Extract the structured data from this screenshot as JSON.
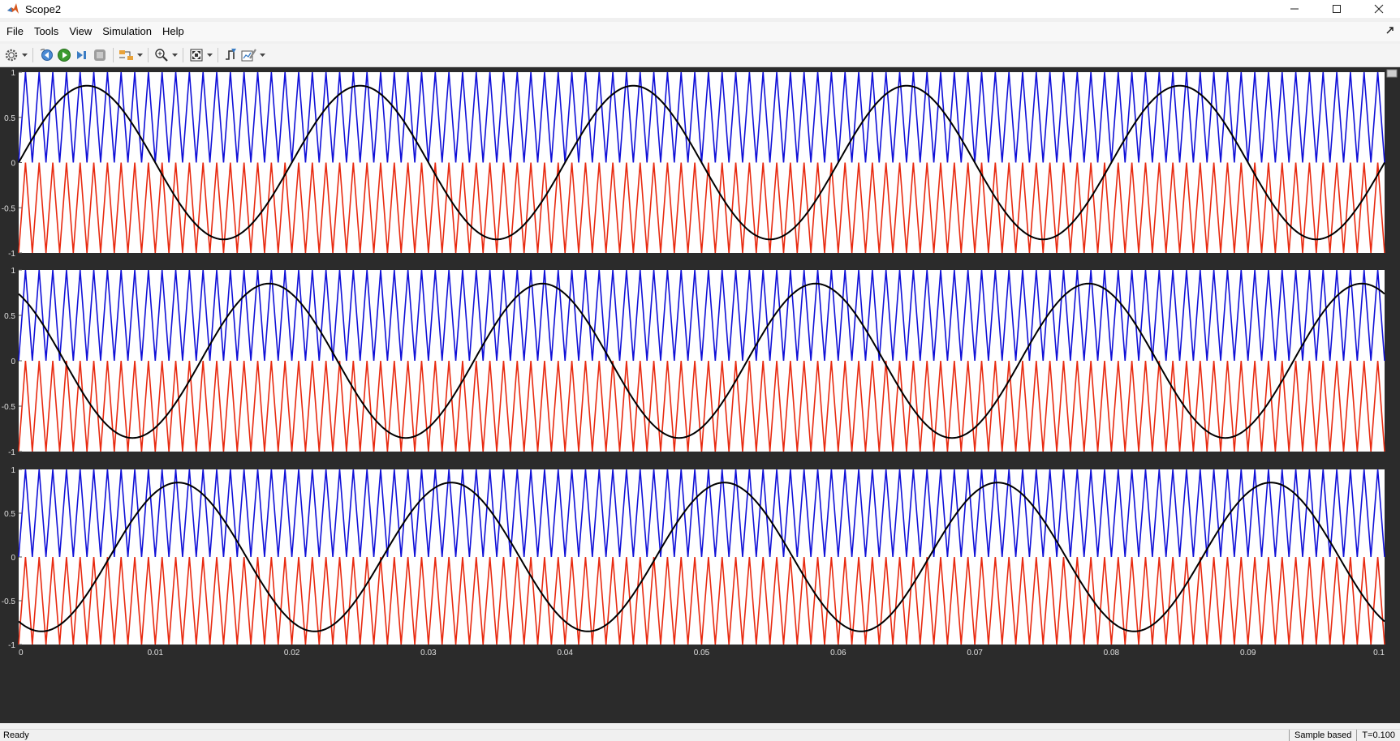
{
  "window": {
    "title": "Scope2"
  },
  "menu": [
    "File",
    "Tools",
    "View",
    "Simulation",
    "Help"
  ],
  "toolbar": [
    {
      "name": "settings-icon",
      "dropdown": true
    },
    {
      "name": "step-back-icon"
    },
    {
      "name": "run-icon"
    },
    {
      "name": "step-forward-icon"
    },
    {
      "name": "stop-icon"
    },
    {
      "name": "highlight-block-icon",
      "dropdown": true
    },
    {
      "name": "zoom-icon",
      "dropdown": true
    },
    {
      "name": "fit-view-icon",
      "dropdown": true
    },
    {
      "name": "triggers-icon"
    },
    {
      "name": "measurements-icon",
      "dropdown": true
    }
  ],
  "status": {
    "text": "Ready",
    "mode": "Sample based",
    "time": "T=0.100"
  },
  "colors": {
    "carrier_positive": "#1010d8",
    "carrier_negative": "#e82a10",
    "reference": "#000000",
    "plot_background": "#ffffff",
    "frame_background": "#2b2b2b"
  },
  "chart_data": [
    {
      "type": "line",
      "xlim": [
        0,
        0.1
      ],
      "ylim": [
        -1,
        1
      ],
      "yticks": [
        1,
        0.5,
        0,
        -0.5,
        -1
      ],
      "ytick_labels": [
        "1",
        "0.5",
        "0",
        "-0.5",
        "-1"
      ],
      "grid": false,
      "series": [
        {
          "role": "carrier-positive",
          "waveform": "triangle",
          "range": [
            0,
            1
          ],
          "frequency_hz": 1000
        },
        {
          "role": "carrier-negative",
          "waveform": "triangle",
          "range": [
            -1,
            0
          ],
          "frequency_hz": 1000
        },
        {
          "role": "reference",
          "waveform": "sine",
          "amplitude": 0.85,
          "frequency_hz": 50,
          "phase_deg": 0
        }
      ]
    },
    {
      "type": "line",
      "xlim": [
        0,
        0.1
      ],
      "ylim": [
        -1,
        1
      ],
      "yticks": [
        1,
        0.5,
        0,
        -0.5,
        -1
      ],
      "ytick_labels": [
        "1",
        "0.5",
        "0",
        "-0.5",
        "-1"
      ],
      "grid": false,
      "series": [
        {
          "role": "carrier-positive",
          "waveform": "triangle",
          "range": [
            0,
            1
          ],
          "frequency_hz": 1000
        },
        {
          "role": "carrier-negative",
          "waveform": "triangle",
          "range": [
            -1,
            0
          ],
          "frequency_hz": 1000
        },
        {
          "role": "reference",
          "waveform": "sine",
          "amplitude": 0.85,
          "frequency_hz": 50,
          "phase_deg": 120
        }
      ]
    },
    {
      "type": "line",
      "xlim": [
        0,
        0.1
      ],
      "ylim": [
        -1,
        1
      ],
      "yticks": [
        1,
        0.5,
        0,
        -0.5,
        -1
      ],
      "ytick_labels": [
        "1",
        "0.5",
        "0",
        "-0.5",
        "-1"
      ],
      "xticks": [
        0,
        0.01,
        0.02,
        0.03,
        0.04,
        0.05,
        0.06,
        0.07,
        0.08,
        0.09,
        0.1
      ],
      "xtick_labels": [
        "0",
        "0.01",
        "0.02",
        "0.03",
        "0.04",
        "0.05",
        "0.06",
        "0.07",
        "0.08",
        "0.09",
        "0.1"
      ],
      "grid": false,
      "series": [
        {
          "role": "carrier-positive",
          "waveform": "triangle",
          "range": [
            0,
            1
          ],
          "frequency_hz": 1000
        },
        {
          "role": "carrier-negative",
          "waveform": "triangle",
          "range": [
            -1,
            0
          ],
          "frequency_hz": 1000
        },
        {
          "role": "reference",
          "waveform": "sine",
          "amplitude": 0.85,
          "frequency_hz": 50,
          "phase_deg": 240
        }
      ]
    }
  ]
}
